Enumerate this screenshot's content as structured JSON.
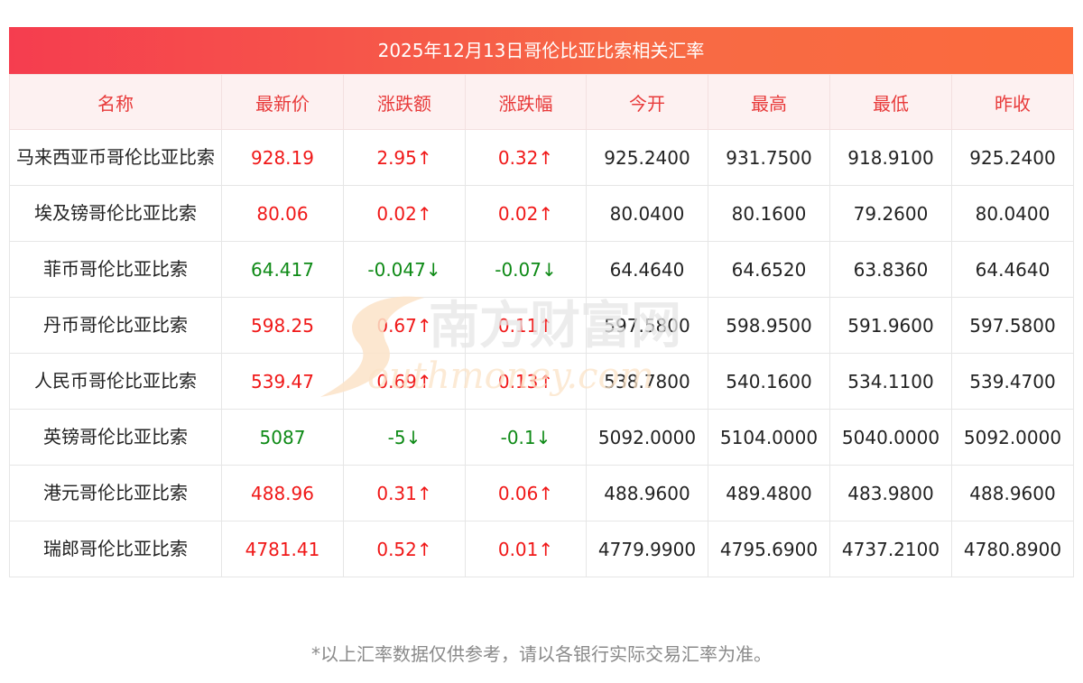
{
  "title": "2025年12月13日哥伦比亚比索相关汇率",
  "columns": [
    "名称",
    "最新价",
    "涨跌额",
    "涨跌幅",
    "今开",
    "最高",
    "最低",
    "昨收"
  ],
  "rows": [
    {
      "name": "马来西亚币哥伦比亚比索",
      "latest": "928.19",
      "change": "2.95↑",
      "change_pct": "0.32↑",
      "open": "925.2400",
      "high": "931.7500",
      "low": "918.9100",
      "prev_close": "925.2400",
      "trend": "up"
    },
    {
      "name": "埃及镑哥伦比亚比索",
      "latest": "80.06",
      "change": "0.02↑",
      "change_pct": "0.02↑",
      "open": "80.0400",
      "high": "80.1600",
      "low": "79.2600",
      "prev_close": "80.0400",
      "trend": "up"
    },
    {
      "name": "菲币哥伦比亚比索",
      "latest": "64.417",
      "change": "-0.047↓",
      "change_pct": "-0.07↓",
      "open": "64.4640",
      "high": "64.6520",
      "low": "63.8360",
      "prev_close": "64.4640",
      "trend": "down"
    },
    {
      "name": "丹币哥伦比亚比索",
      "latest": "598.25",
      "change": "0.67↑",
      "change_pct": "0.11↑",
      "open": "597.5800",
      "high": "598.9500",
      "low": "591.9600",
      "prev_close": "597.5800",
      "trend": "up"
    },
    {
      "name": "人民币哥伦比亚比索",
      "latest": "539.47",
      "change": "0.69↑",
      "change_pct": "0.13↑",
      "open": "538.7800",
      "high": "540.1600",
      "low": "534.1100",
      "prev_close": "539.4700",
      "trend": "up"
    },
    {
      "name": "英镑哥伦比亚比索",
      "latest": "5087",
      "change": "-5↓",
      "change_pct": "-0.1↓",
      "open": "5092.0000",
      "high": "5104.0000",
      "low": "5040.0000",
      "prev_close": "5092.0000",
      "trend": "down"
    },
    {
      "name": "港元哥伦比亚比索",
      "latest": "488.96",
      "change": "0.31↑",
      "change_pct": "0.06↑",
      "open": "488.9600",
      "high": "489.4800",
      "low": "483.9800",
      "prev_close": "488.9600",
      "trend": "up"
    },
    {
      "name": "瑞郎哥伦比亚比索",
      "latest": "4781.41",
      "change": "0.52↑",
      "change_pct": "0.01↑",
      "open": "4779.9900",
      "high": "4795.6900",
      "low": "4737.2100",
      "prev_close": "4780.8900",
      "trend": "up"
    }
  ],
  "watermark": {
    "cn": "南方财富网",
    "en": "outhmoney.com",
    "icon": "s-logo"
  },
  "footnote": "*以上汇率数据仅供参考，请以各银行实际交易汇率为准。",
  "colors": {
    "up": "#f01818",
    "down": "#0e8a16",
    "header_text": "#e83a3a",
    "header_bg": "#fdf1f1",
    "title_gradient_start": "#f53d4f",
    "title_gradient_end": "#fb6a3d"
  }
}
